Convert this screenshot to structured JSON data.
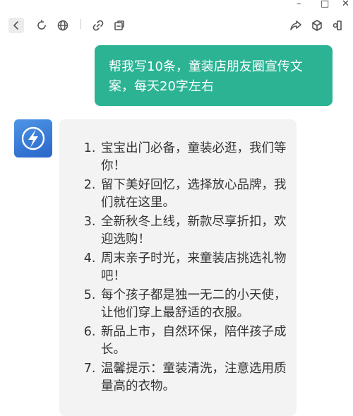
{
  "window_controls": {
    "minimize": "–",
    "maximize": "□",
    "close": "✕"
  },
  "toolbar": {
    "left_icons": [
      "back-icon",
      "refresh-icon",
      "globe-icon",
      "link-icon",
      "puzzle-icon"
    ],
    "right_icons": [
      "share-icon",
      "cube-icon",
      "exit-icon"
    ]
  },
  "conversation": {
    "user_message": "帮我写10条，童装店朋友圈宣传文案，每天20字左右",
    "assistant_items": [
      "宝宝出门必备，童装必逛，我们等你！",
      "留下美好回忆，选择放心品牌，我们就在这里。",
      "全新秋冬上线，新款尽享折扣，欢迎选购！",
      "周末亲子时光，来童装店挑选礼物吧！",
      "每个孩子都是独一无二的小天使，让他们穿上最舒适的衣服。",
      "新品上市，自然环保，陪伴孩子成长。",
      "温馨提示：童装清洗，注意选用质量高的衣物。"
    ]
  },
  "colors": {
    "user_bubble": "#2bb394",
    "bot_bubble": "#f3f3f4",
    "avatar": "#3a7fd9"
  }
}
